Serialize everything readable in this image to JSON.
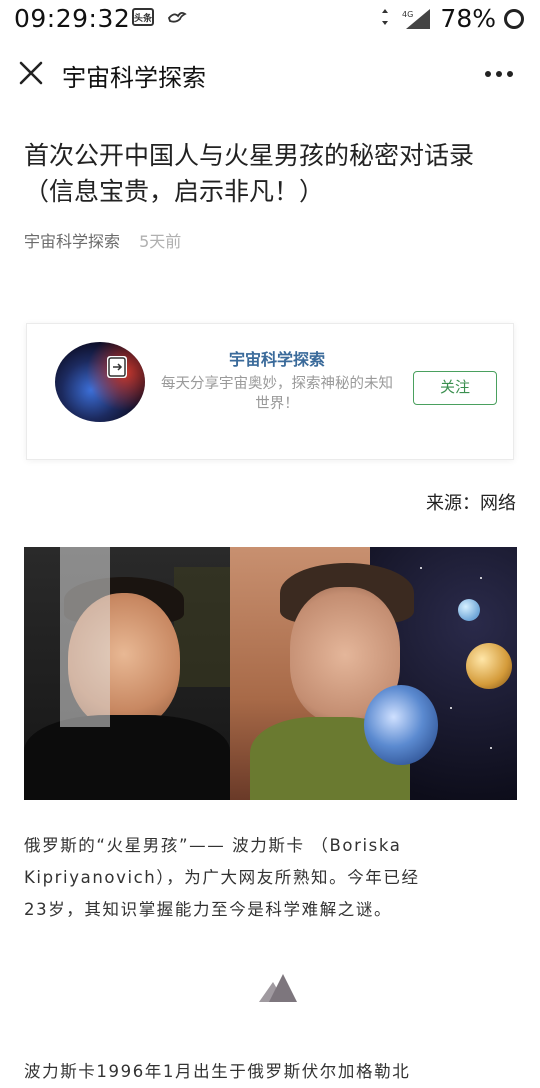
{
  "status_bar": {
    "time": "09:29:32",
    "news_badge": "头条",
    "network": "4G",
    "battery": "78%"
  },
  "header": {
    "title": "宇宙科学探索",
    "more_label": "..."
  },
  "article": {
    "title_line1": "首次公开中国人与火星男孩的秘密对话录",
    "title_line2": "（信息宝贵，启示非凡！）",
    "author": "宇宙科学探索",
    "time": "5天前",
    "source": "来源：网络",
    "paragraph1_line1": "俄罗斯的“火星男孩”—— 波力斯卡 （Boriska",
    "paragraph1_line2": "Kipriyanovich），为广大网友所熟知。今年已经",
    "paragraph1_line3": "23岁，其知识掌握能力至今是科学难解之谜。",
    "paragraph2_line1": "波力斯卡1996年1月出生于俄罗斯伏尔加格勒北"
  },
  "account_card": {
    "name": "宇宙科学探索",
    "description": "每天分享宇宙奥妙，探索神秘的未知世界！",
    "follow_label": "关注"
  },
  "colors": {
    "follow_green": "#4aa05e",
    "account_name_blue": "#3a6a9a",
    "meta_gray": "#6b6b6b",
    "time_gray": "#b0b0b0"
  },
  "icons": [
    "close-icon",
    "more-icon",
    "exit-icon",
    "mountain-divider-icon",
    "wifi-icon",
    "signal-icon",
    "battery-icon",
    "news-icon",
    "bird-icon"
  ]
}
